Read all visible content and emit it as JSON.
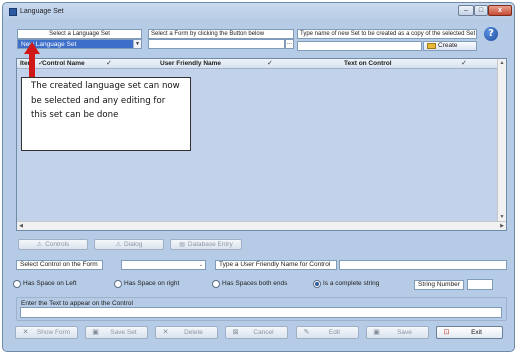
{
  "window": {
    "title": "Language Set"
  },
  "controls": {
    "minimize": "–",
    "maximize": "□",
    "close": "x"
  },
  "top": {
    "language_set_label": "Select a Language Set",
    "language_set_value": "New Language Set",
    "form_label": "Select a Form by clicking the Button below",
    "form_value": "",
    "form_browse": "...",
    "copy_label": "Type name of new Set to be created as a copy of the selected Set",
    "copy_value": "",
    "create_button": "Create",
    "help": "?"
  },
  "grid": {
    "columns": [
      {
        "label": "Item"
      },
      {
        "label": "Control Name"
      },
      {
        "label": "User Friendly Name"
      },
      {
        "label": "Text on Control"
      }
    ],
    "check": "✓"
  },
  "callout": {
    "text": "The created language set can now be selected and any editing for this set can be done"
  },
  "toolbar": {
    "controls": "Controls",
    "dialog": "Dialog",
    "database_entry": "Database Entry"
  },
  "control_row": {
    "select_control_label": "Select Control on the Form",
    "select_control_value": "",
    "friendly_name_label": "Type a User Friendly Name for Control",
    "friendly_name_value": ""
  },
  "radios": {
    "left": "Has Space on Left",
    "right": "Has Space on right",
    "both": "Has Spaces both ends",
    "complete": "Is a complete string",
    "selected": "complete"
  },
  "string_number": {
    "label": "String Number",
    "value": ""
  },
  "text_group": {
    "label": "Enter the Text to appear on the Control",
    "value": ""
  },
  "buttons": {
    "show_form": "Show Form",
    "save_set": "Save Set",
    "delete": "Delete",
    "cancel": "Cancel",
    "edit": "Edit",
    "save": "Save",
    "exit": "Exit"
  },
  "colors": {
    "window_bg": "#b6cbe6",
    "selection": "#3d6ec9",
    "callout_arrow": "#d01818"
  }
}
